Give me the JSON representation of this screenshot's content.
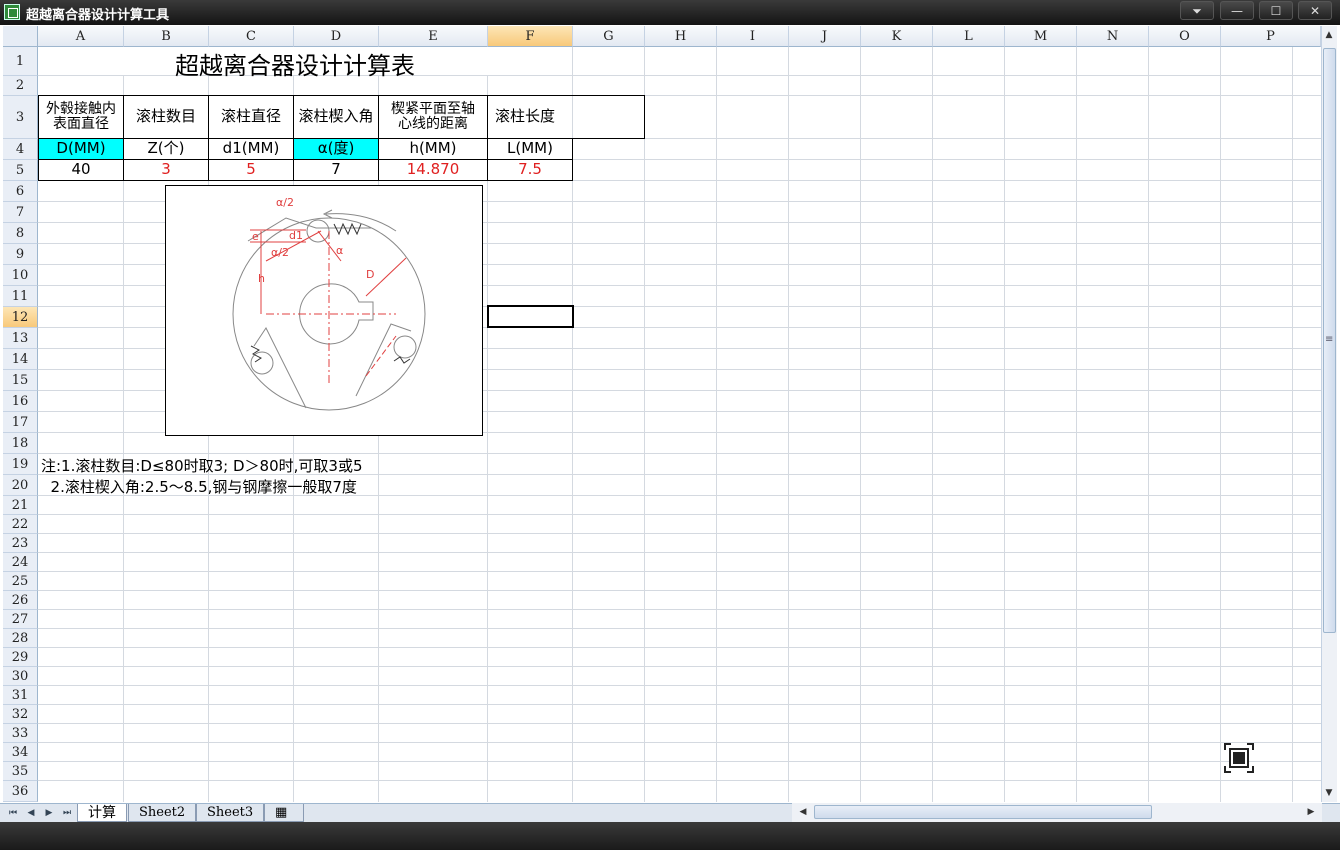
{
  "window": {
    "title": "超越离合器设计计算工具"
  },
  "columns": [
    "A",
    "B",
    "C",
    "D",
    "E",
    "F",
    "G",
    "H",
    "I",
    "J",
    "K",
    "L",
    "M",
    "N",
    "O",
    "P"
  ],
  "rows": [
    "1",
    "2",
    "3",
    "4",
    "5",
    "6",
    "7",
    "8",
    "9",
    "10",
    "11",
    "12",
    "13",
    "14",
    "15",
    "16",
    "17",
    "18",
    "19",
    "20",
    "21",
    "22",
    "23",
    "24",
    "25",
    "26",
    "27",
    "28",
    "29",
    "30",
    "31",
    "32",
    "33",
    "34",
    "35",
    "36"
  ],
  "selected_cell": "F12",
  "sheet": {
    "title": "超越离合器设计计算表",
    "headers": [
      "外毂接触内表面直径",
      "滚柱数目",
      "滚柱直径",
      "滚柱楔入角",
      "楔紧平面至轴心线的距离",
      "滚柱长度"
    ],
    "units": [
      "D(MM)",
      "Z(个)",
      "d1(MM)",
      "α(度)",
      "h(MM)",
      "L(MM)"
    ],
    "values": [
      "40",
      "3",
      "5",
      "7",
      "14.870",
      "7.5"
    ],
    "notes": [
      "注:1.滚柱数目:D≤80时取3;  D＞80时,可取3或5",
      "  2.滚柱楔入角:2.5～8.5,钢与钢摩擦一般取7度"
    ]
  },
  "drawing": {
    "labels": {
      "half_angle_top": "α/2",
      "half_angle_mid": "α/2",
      "angle": "α",
      "roller_dia": "d1",
      "dist": "h",
      "outer_dia": "D",
      "e": "e"
    }
  },
  "tabs": [
    "计算",
    "Sheet2",
    "Sheet3"
  ],
  "colors": {
    "accent_cyan": "#00ffff",
    "result_red": "#e02020",
    "selected_header": "#f8c97a"
  }
}
